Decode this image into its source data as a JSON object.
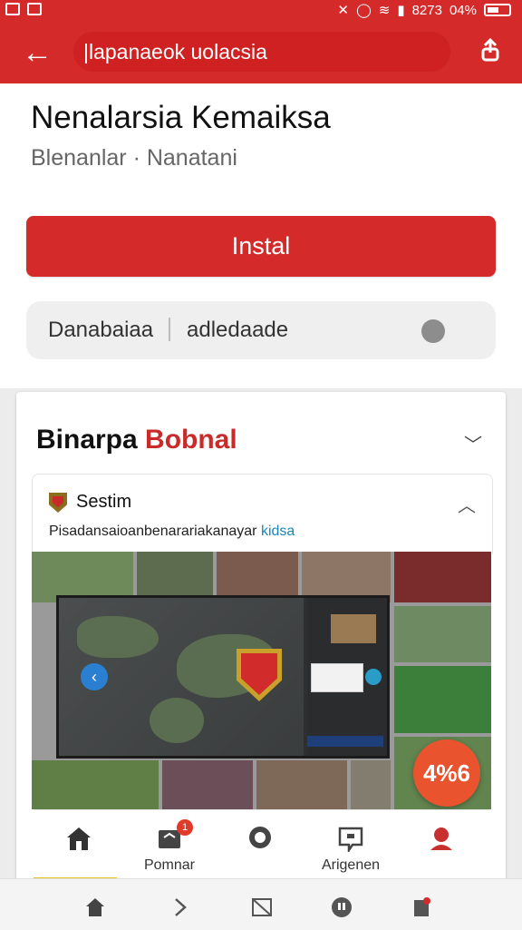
{
  "status_bar": {
    "time": "8273",
    "battery": "04%"
  },
  "app_bar": {
    "search_text": "|lapanaeok uolacsia"
  },
  "app": {
    "title": "Nenalarsia Kemaiksa",
    "subtitle": "Blenanlar · Nanatani",
    "install_label": "Instal"
  },
  "meta": {
    "item1": "Danabaiaa",
    "item2": "adledaade"
  },
  "section": {
    "title_plain": "Binarpa ",
    "title_accent": "Bobnal"
  },
  "subcard": {
    "name": "Sestim",
    "description": "Pisadansaioanbenarariakanayar ",
    "description_link": "kidsa"
  },
  "fab": {
    "label": "4%6"
  },
  "tabs": [
    {
      "label": ""
    },
    {
      "label": "Pomnar",
      "badge": "1"
    },
    {
      "label": ""
    },
    {
      "label": "Arigenen"
    },
    {
      "label": ""
    }
  ],
  "colors": {
    "brand": "#d42a2a",
    "accent_link": "#1a87b8",
    "fab": "#e9542f"
  }
}
